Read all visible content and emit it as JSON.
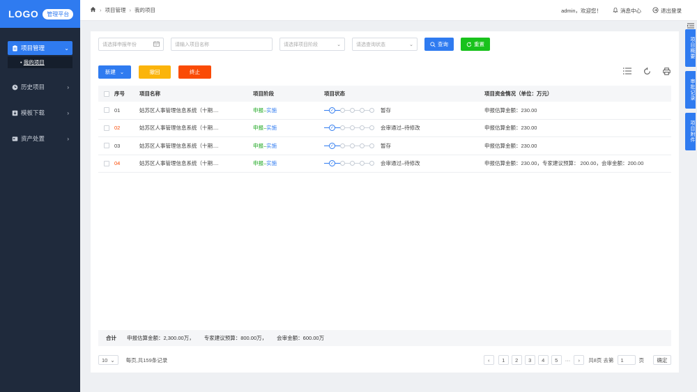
{
  "sidebar": {
    "logo": "LOGO",
    "badge": "管理平台",
    "items": [
      {
        "label": "项目管理",
        "icon": "clipboard-icon",
        "chevron": "⌄"
      },
      {
        "label": "历史项目",
        "icon": "clock-icon",
        "chevron": "›"
      },
      {
        "label": "模板下载",
        "icon": "download-icon",
        "chevron": "›"
      },
      {
        "label": "资产处置",
        "icon": "card-icon",
        "chevron": "›"
      }
    ],
    "sub_item": "我的项目",
    "sub_bullet": "•"
  },
  "header": {
    "crumbs": [
      "项目管理",
      "我的项目"
    ],
    "welcome": "admin，欢迎您！",
    "messages": "消息中心",
    "logout": "退出登录"
  },
  "rail": {
    "tabs": [
      "项目概要",
      "审批记录",
      "项目附件"
    ]
  },
  "filters": {
    "year_placeholder": "请选择申报年份",
    "name_placeholder": "请输入项目名称",
    "stage_placeholder": "请选择项目阶段",
    "status_placeholder": "请选查询状态",
    "query_label": "查询",
    "reset_label": "重置"
  },
  "actions": {
    "new_label": "新建",
    "revoke_label": "撤回",
    "stop_label": "终止"
  },
  "table": {
    "headers": [
      "序号",
      "项目名称",
      "项目阶段",
      "项目状态",
      "项目资金情况（单位：万元）"
    ],
    "stage_sep": "–",
    "rows": [
      {
        "no": "01",
        "name": "姑苏区人事管理信息系统（十期....",
        "stage_a": "申报",
        "stage_b": "实施",
        "status": "暂存",
        "fund": "申报估算金额：230.00"
      },
      {
        "no": "02",
        "name": "姑苏区人事管理信息系统（十期....",
        "stage_a": "申报",
        "stage_b": "实施",
        "status": "会审通过–待修改",
        "fund": "申报估算金额：230.00"
      },
      {
        "no": "03",
        "name": "姑苏区人事管理信息系统（十期....",
        "stage_a": "申报",
        "stage_b": "实施",
        "status": "暂存",
        "fund": "申报估算金额：230.00"
      },
      {
        "no": "04",
        "name": "姑苏区人事管理信息系统（十期....",
        "stage_a": "申报",
        "stage_b": "实施",
        "status": "会审通过–待修改",
        "fund": "申报估算金额：230.00，专家建议预算： 200.00，会审金额：200.00"
      }
    ]
  },
  "summary": {
    "total_label": "合计",
    "declared": "申报估算金额：2,300.00万，",
    "expert": "专家建议预算：800.00万，",
    "review": "会审金额：600.00万"
  },
  "pager": {
    "page_size": "10",
    "per_page_text": "每页,共159条记录",
    "pages": [
      "1",
      "2",
      "3",
      "4",
      "5"
    ],
    "ellipsis": "···",
    "total_pages": "共8页 去第",
    "goto_value": "1",
    "page_unit": "页",
    "confirm": "确定"
  },
  "colors": {
    "primary": "#2f7bf0",
    "success": "#19c21c",
    "warning": "#fbb40b",
    "danger": "#fa4b06",
    "sidebar": "#1f2a3c"
  }
}
